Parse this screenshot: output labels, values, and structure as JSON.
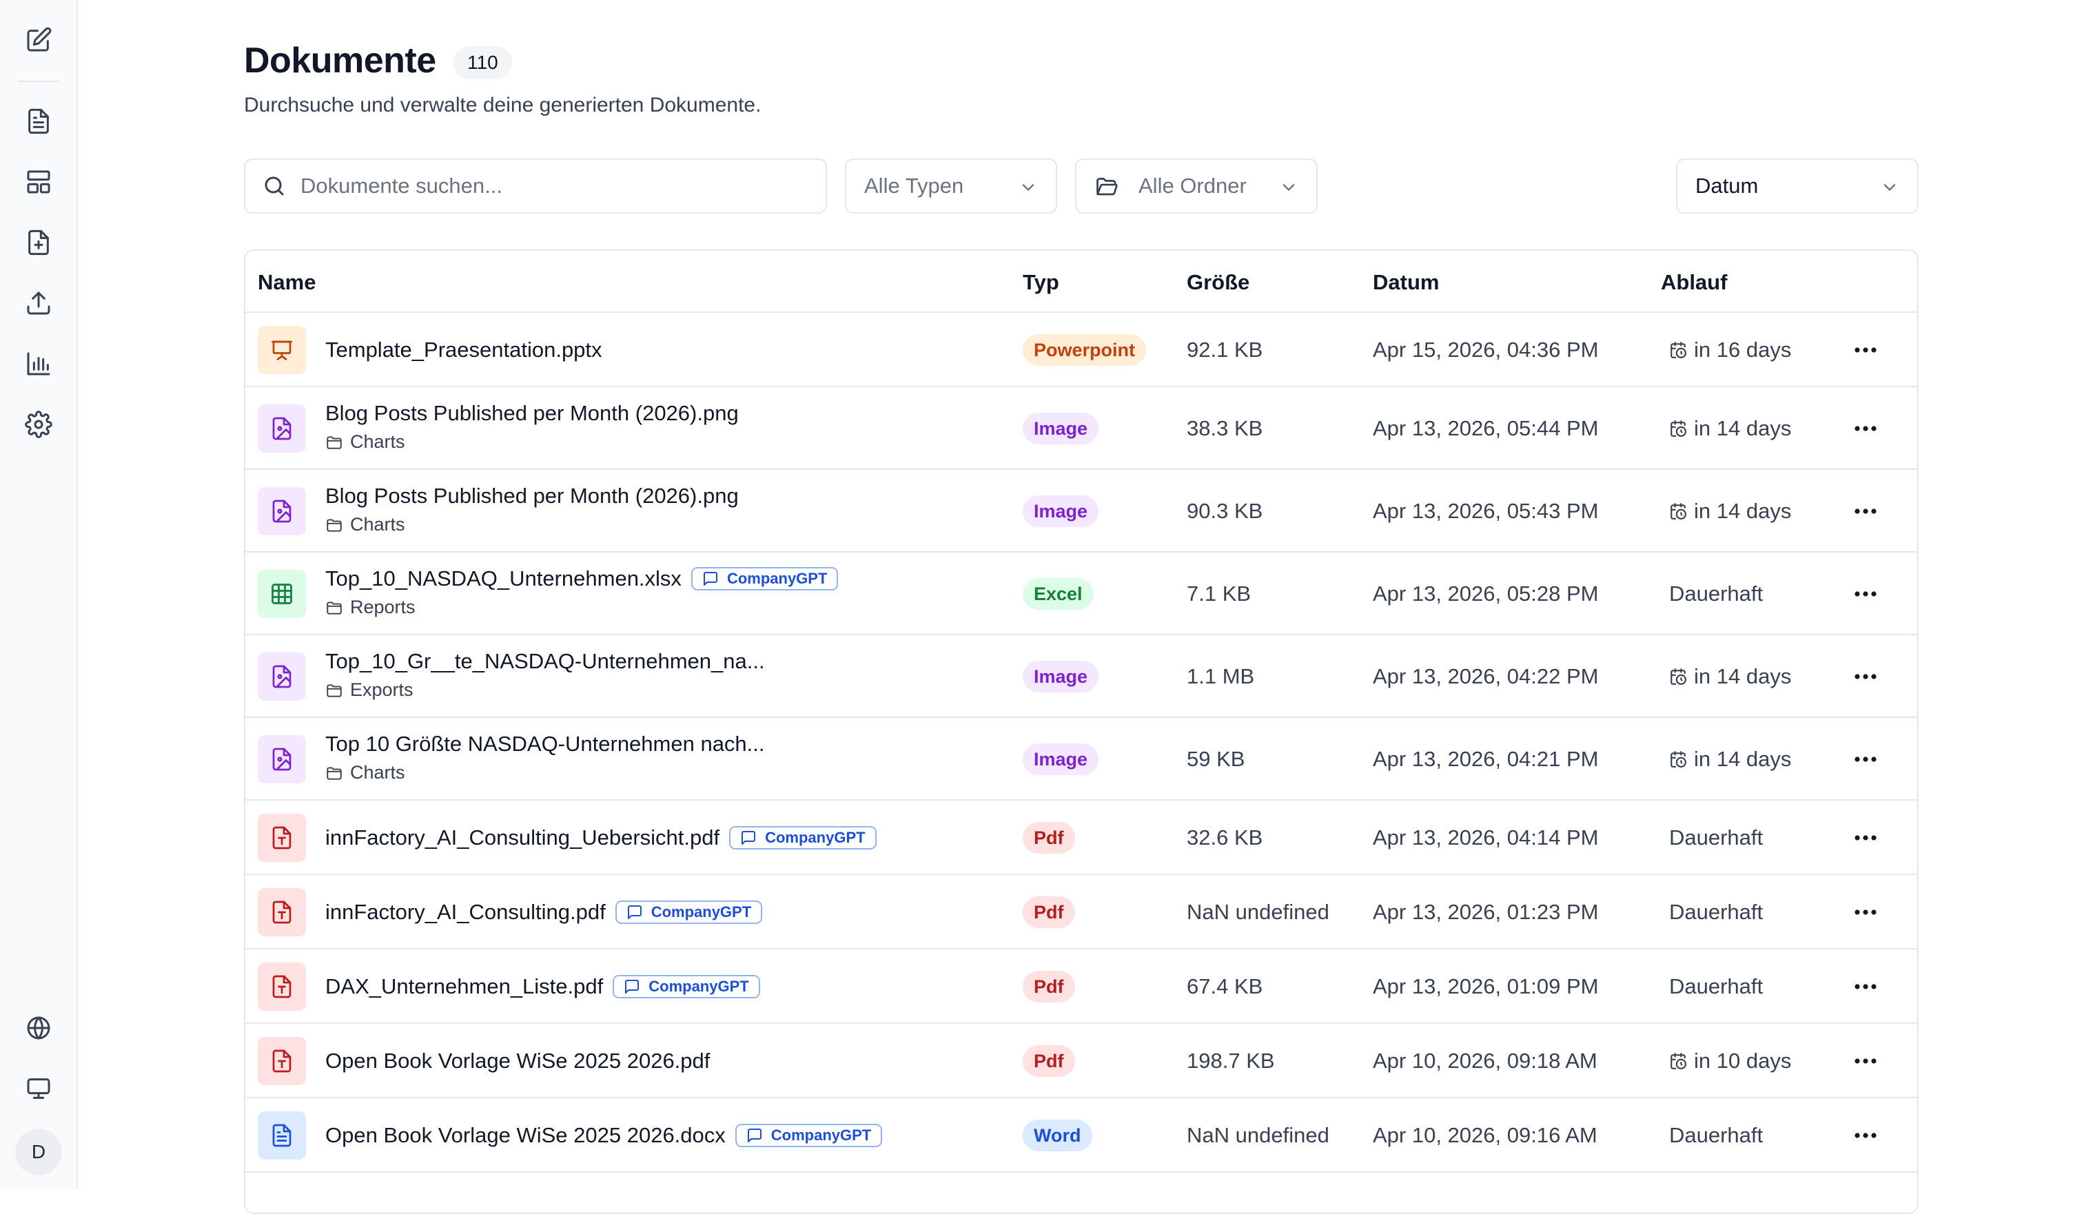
{
  "header": {
    "title": "Dokumente",
    "count": "110",
    "subtitle": "Durchsuche und verwalte deine generierten Dokumente."
  },
  "filters": {
    "search_placeholder": "Dokumente suchen...",
    "types_label": "Alle Typen",
    "folders_label": "Alle Ordner",
    "sort_label": "Datum"
  },
  "sidebar": {
    "top_items": [
      "edit-icon",
      "documents-icon",
      "layout-icon",
      "new-file-icon",
      "upload-icon",
      "analytics-icon",
      "settings-icon"
    ],
    "bottom_items": [
      "globe-icon",
      "monitor-icon"
    ],
    "avatar": "D"
  },
  "table": {
    "columns": [
      "Name",
      "Typ",
      "Größe",
      "Datum",
      "Ablauf"
    ],
    "rows": [
      {
        "name": "Template_Praesentation.pptx",
        "folder": "",
        "tag": "",
        "type": "Powerpoint",
        "size": "92.1 KB",
        "date": "Apr 15, 2026, 04:36 PM",
        "expiry": "in 16 days",
        "expiry_icon": true
      },
      {
        "name": "Blog Posts Published per Month (2026).png",
        "folder": "Charts",
        "tag": "",
        "type": "Image",
        "size": "38.3 KB",
        "date": "Apr 13, 2026, 05:44 PM",
        "expiry": "in 14 days",
        "expiry_icon": true
      },
      {
        "name": "Blog Posts Published per Month (2026).png",
        "folder": "Charts",
        "tag": "",
        "type": "Image",
        "size": "90.3 KB",
        "date": "Apr 13, 2026, 05:43 PM",
        "expiry": "in 14 days",
        "expiry_icon": true
      },
      {
        "name": "Top_10_NASDAQ_Unternehmen.xlsx",
        "folder": "Reports",
        "tag": "CompanyGPT",
        "type": "Excel",
        "size": "7.1 KB",
        "date": "Apr 13, 2026, 05:28 PM",
        "expiry": "Dauerhaft",
        "expiry_icon": false
      },
      {
        "name": "Top_10_Gr__te_NASDAQ-Unternehmen_na...",
        "folder": "Exports",
        "tag": "",
        "type": "Image",
        "size": "1.1 MB",
        "date": "Apr 13, 2026, 04:22 PM",
        "expiry": "in 14 days",
        "expiry_icon": true
      },
      {
        "name": "Top 10 Größte NASDAQ-Unternehmen nach...",
        "folder": "Charts",
        "tag": "",
        "type": "Image",
        "size": "59 KB",
        "date": "Apr 13, 2026, 04:21 PM",
        "expiry": "in 14 days",
        "expiry_icon": true
      },
      {
        "name": "innFactory_AI_Consulting_Uebersicht.pdf",
        "folder": "",
        "tag": "CompanyGPT",
        "type": "Pdf",
        "size": "32.6 KB",
        "date": "Apr 13, 2026, 04:14 PM",
        "expiry": "Dauerhaft",
        "expiry_icon": false
      },
      {
        "name": "innFactory_AI_Consulting.pdf",
        "folder": "",
        "tag": "CompanyGPT",
        "type": "Pdf",
        "size": "NaN undefined",
        "date": "Apr 13, 2026, 01:23 PM",
        "expiry": "Dauerhaft",
        "expiry_icon": false
      },
      {
        "name": "DAX_Unternehmen_Liste.pdf",
        "folder": "",
        "tag": "CompanyGPT",
        "type": "Pdf",
        "size": "67.4 KB",
        "date": "Apr 13, 2026, 01:09 PM",
        "expiry": "Dauerhaft",
        "expiry_icon": false
      },
      {
        "name": "Open Book Vorlage WiSe 2025 2026.pdf",
        "folder": "",
        "tag": "",
        "type": "Pdf",
        "size": "198.7 KB",
        "date": "Apr 10, 2026, 09:18 AM",
        "expiry": "in 10 days",
        "expiry_icon": true
      },
      {
        "name": "Open Book Vorlage WiSe 2025 2026.docx",
        "folder": "",
        "tag": "CompanyGPT",
        "type": "Word",
        "size": "NaN undefined",
        "date": "Apr 10, 2026, 09:16 AM",
        "expiry": "Dauerhaft",
        "expiry_icon": false
      }
    ]
  },
  "colors": {
    "accent_blue": "#1d4ed8",
    "powerpoint": "#c2410c",
    "image": "#7e22ce",
    "excel": "#15803d",
    "pdf": "#b91c1c",
    "word": "#1d4ed8"
  }
}
